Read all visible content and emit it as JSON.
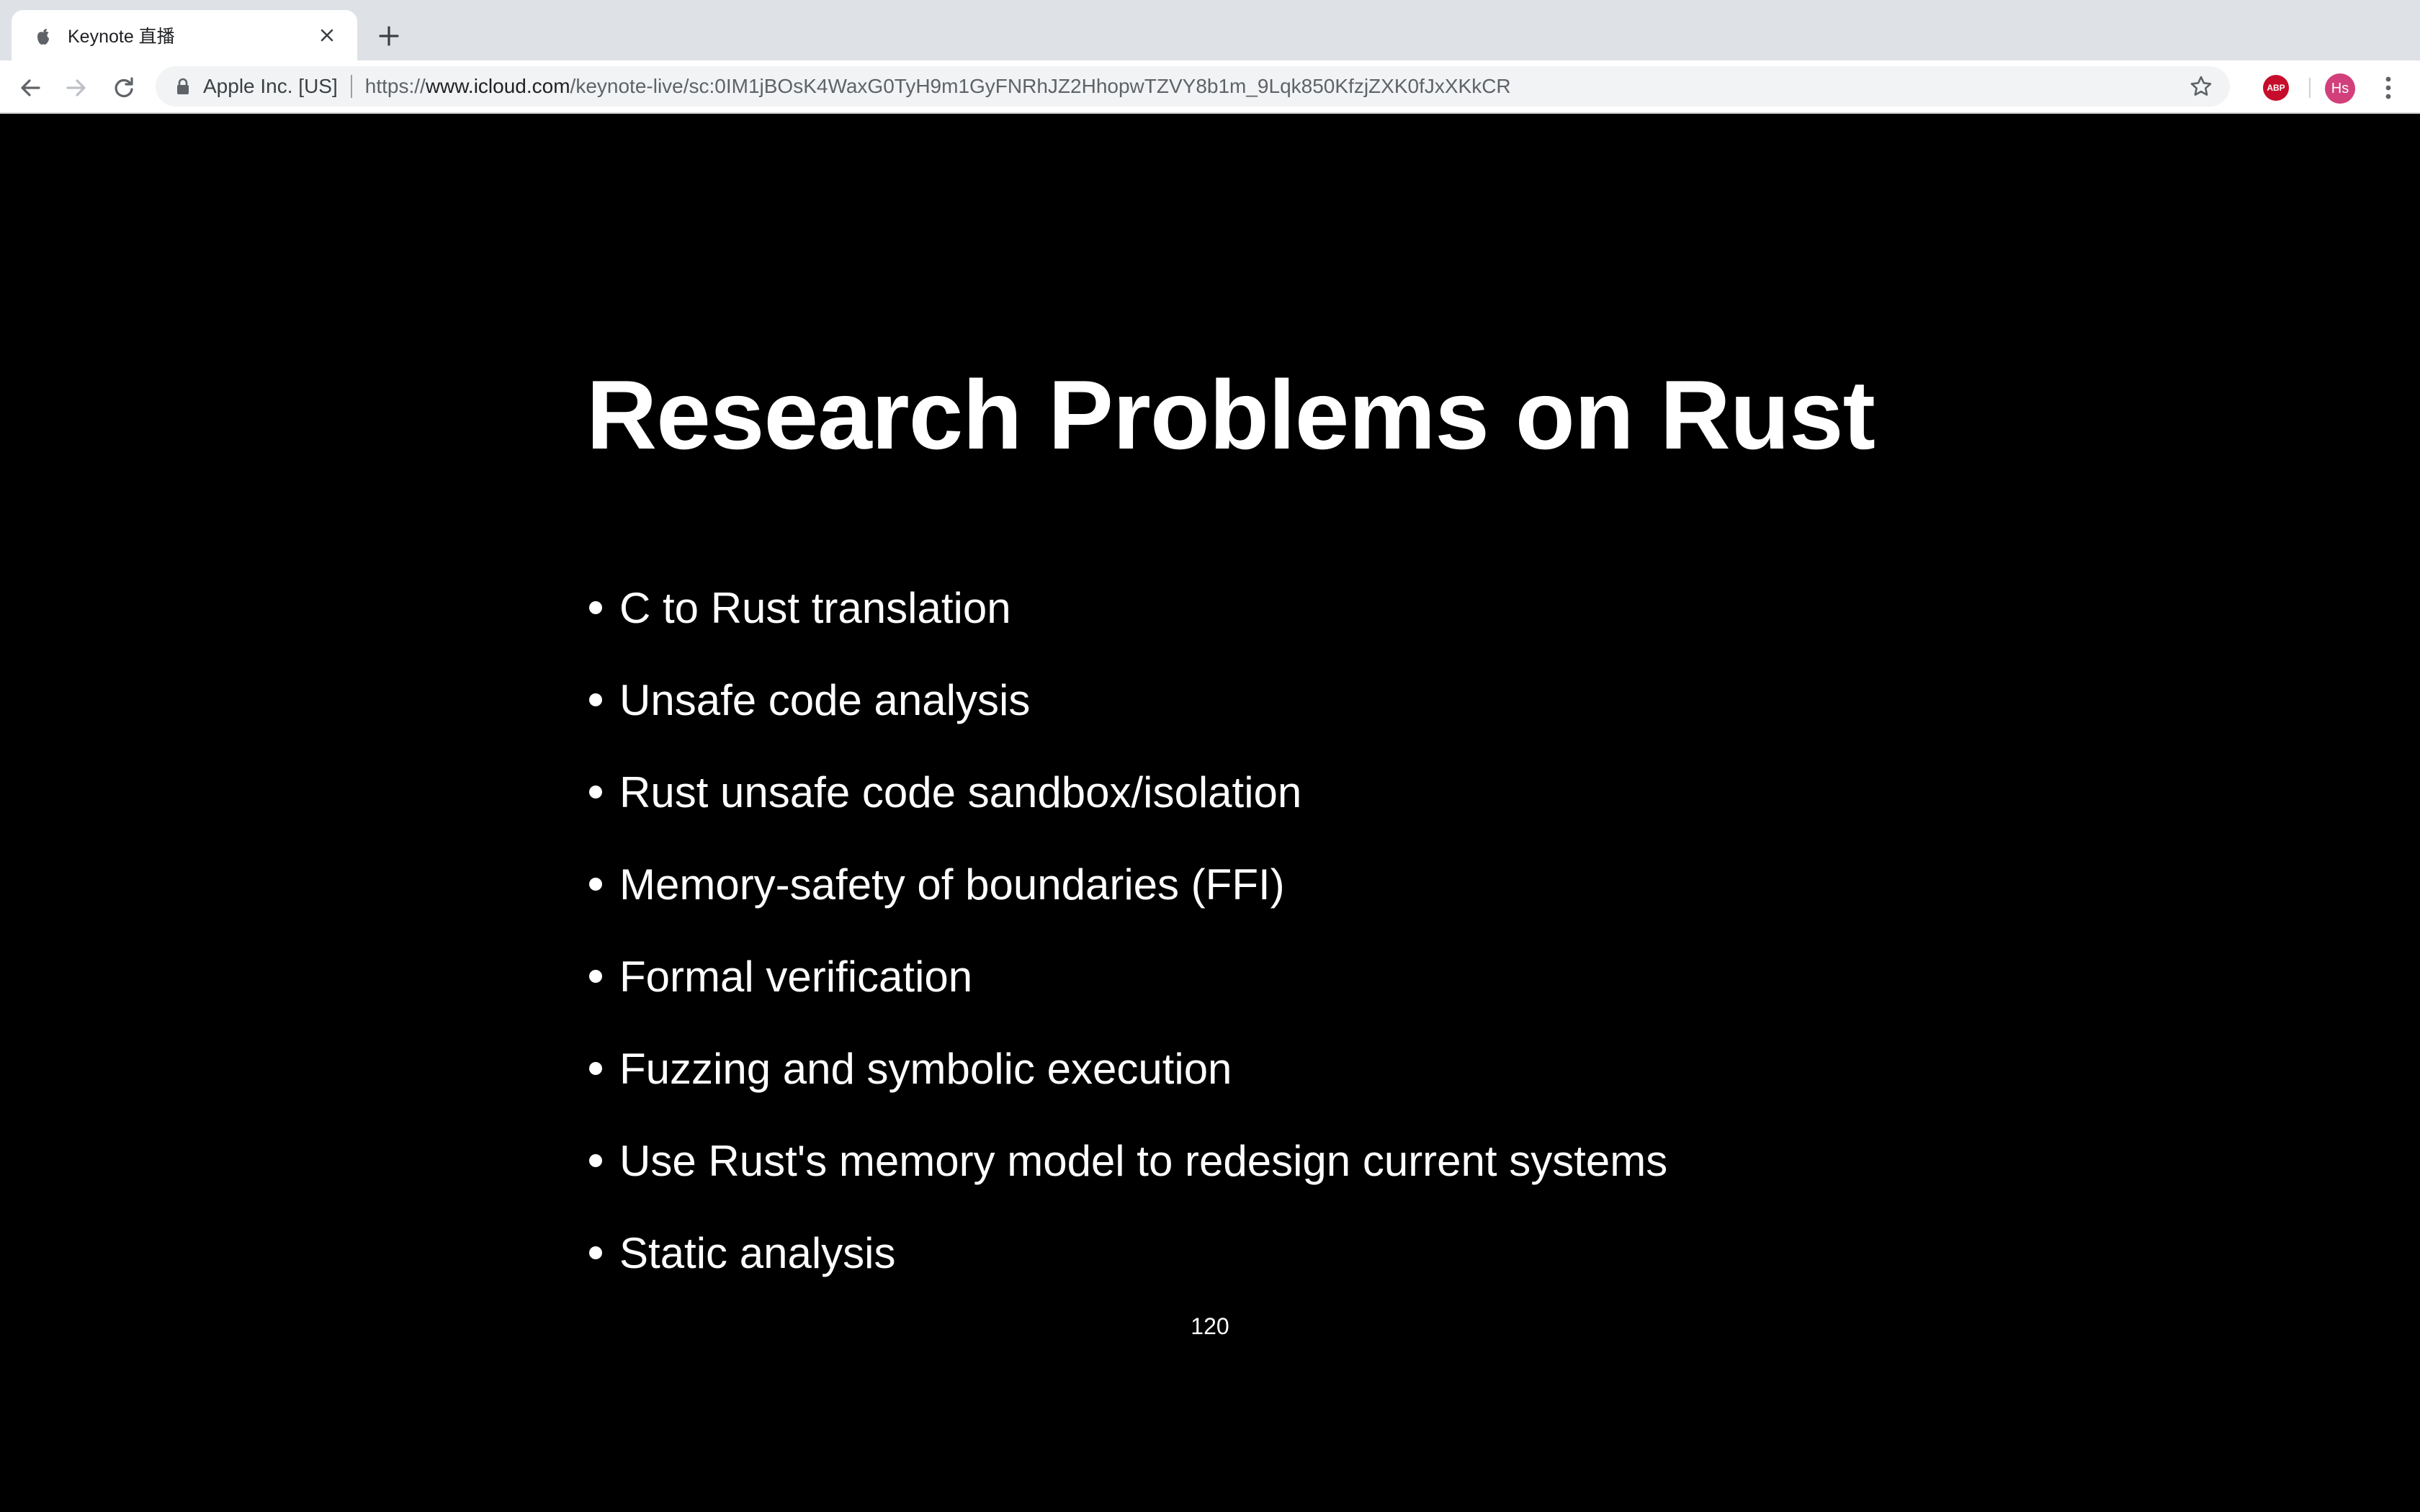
{
  "browser": {
    "tab": {
      "title": "Keynote 直播",
      "favicon": "apple-icon"
    },
    "toolbar": {
      "origin_label": "Apple Inc. [US]",
      "url_scheme": "https://",
      "url_host": "www.icloud.com",
      "url_path": "/keynote-live/sc:0IM1jBOsK4WaxG0TyH9m1GyFNRhJZ2HhopwTZVY8b1m_9Lqk850KfzjZXK0fJxXKkCR"
    },
    "extensions": {
      "abp_label": "ABP"
    },
    "profile": {
      "initials": "Hs",
      "color": "#d1407a"
    }
  },
  "slide": {
    "title": "Research Problems on Rust",
    "bullets": [
      "C to Rust translation",
      "Unsafe code analysis",
      "Rust unsafe code sandbox/isolation",
      "Memory-safety of boundaries (FFI)",
      "Formal verification",
      "Fuzzing and symbolic execution",
      "Use Rust's memory model to redesign current systems",
      "Static analysis"
    ],
    "page_number": "120",
    "background": "#000000",
    "text_color": "#ffffff"
  }
}
